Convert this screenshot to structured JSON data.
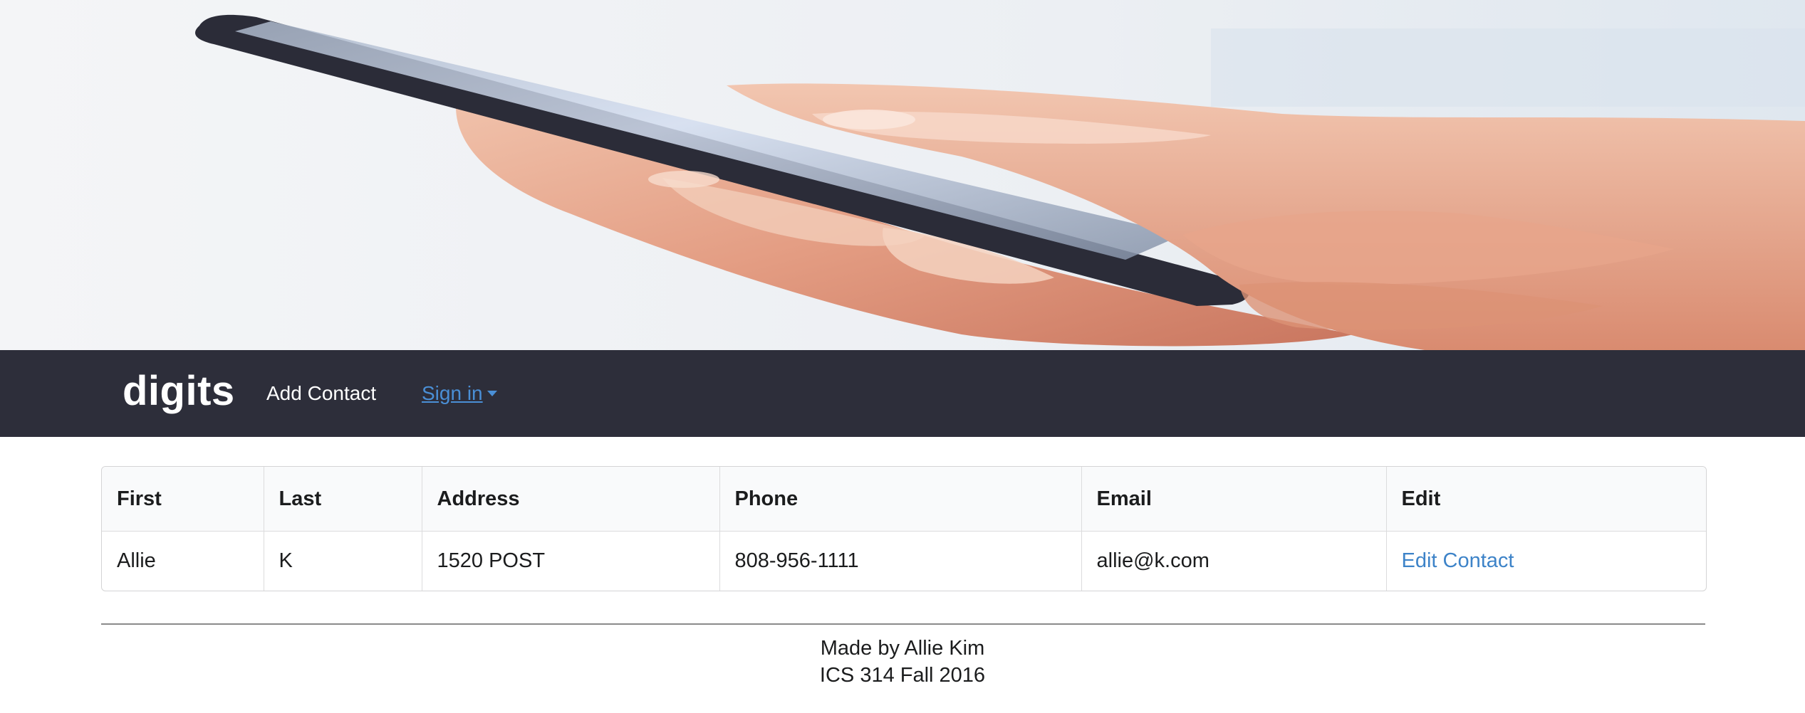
{
  "navbar": {
    "brand": "digits",
    "add_contact": "Add Contact",
    "sign_in": "Sign in"
  },
  "table": {
    "headers": [
      "First",
      "Last",
      "Address",
      "Phone",
      "Email",
      "Edit"
    ],
    "rows": [
      {
        "first": "Allie",
        "last": "K",
        "address": "1520 POST",
        "phone": "808-956-1111",
        "email": "allie@k.com",
        "edit": "Edit Contact"
      }
    ]
  },
  "footer": {
    "line1": "Made by Allie Kim",
    "line2": "ICS 314 Fall 2016"
  },
  "colors": {
    "navbar_bg": "#2d2e3a",
    "link_blue": "#4a8fd6"
  }
}
